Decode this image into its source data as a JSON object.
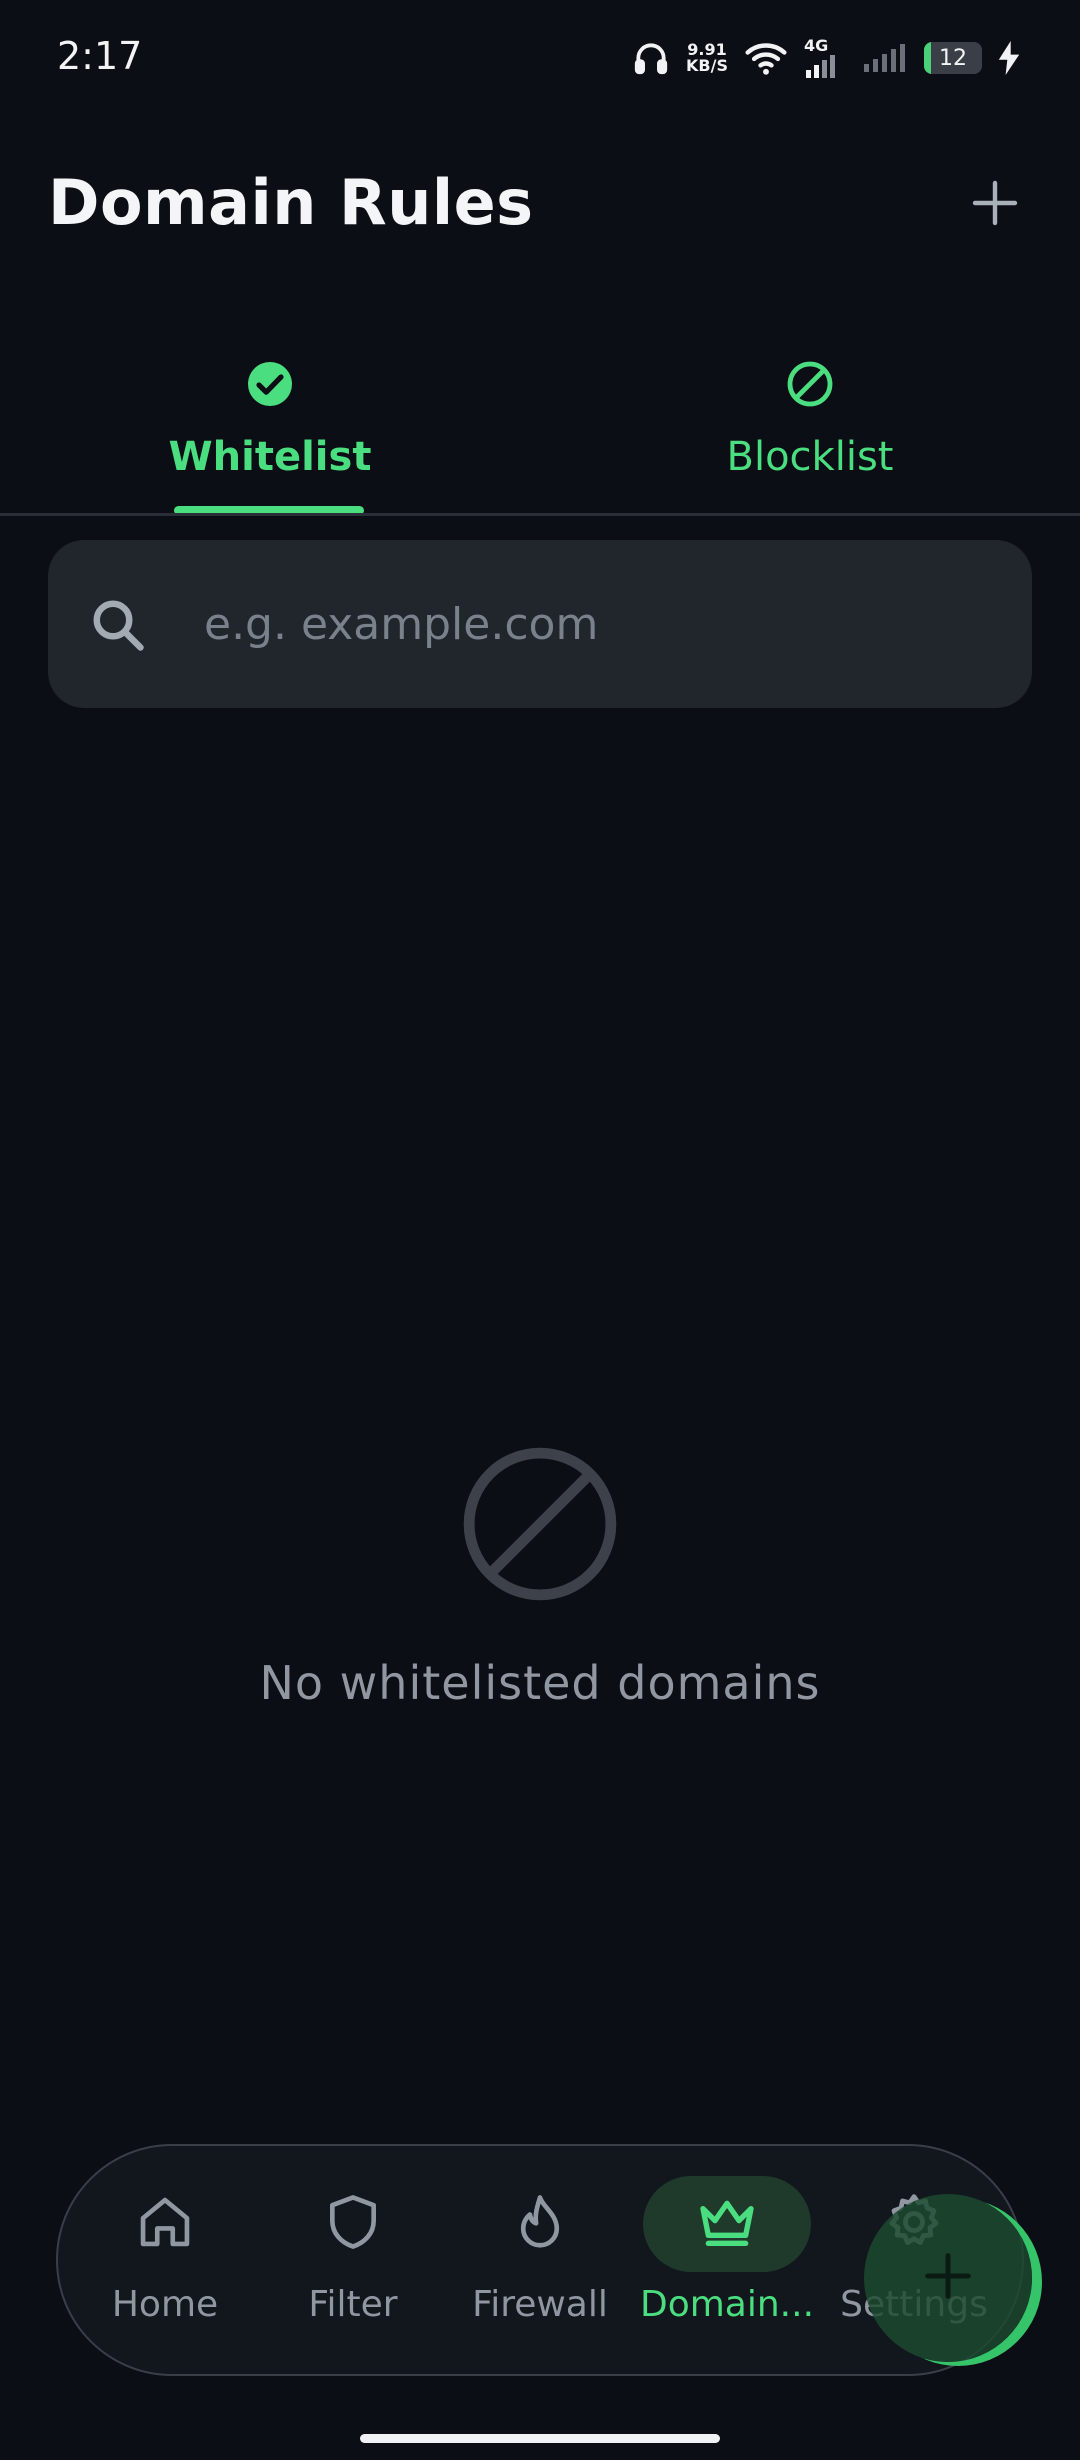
{
  "status_bar": {
    "time": "2:17",
    "net_speed_value": "9.91",
    "net_speed_unit": "KB/S",
    "network_type": "4G",
    "battery_level": "12",
    "battery_fraction": 0.12,
    "icons": [
      "headphones-icon",
      "wifi-icon",
      "signal-icon",
      "charging-icon"
    ]
  },
  "header": {
    "title": "Domain Rules",
    "add_icon": "plus-icon"
  },
  "tabs": [
    {
      "label": "Whitelist",
      "icon": "check-circle-icon",
      "selected": true
    },
    {
      "label": "Blocklist",
      "icon": "block-icon",
      "selected": false
    }
  ],
  "search": {
    "value": "",
    "placeholder": "e.g. example.com",
    "icon": "search-icon"
  },
  "empty_state": {
    "icon": "block-icon",
    "message": "No whitelisted domains"
  },
  "bottom_nav": [
    {
      "label": "Home",
      "icon": "home-icon",
      "active": false
    },
    {
      "label": "Filter",
      "icon": "shield-icon",
      "active": false
    },
    {
      "label": "Firewall",
      "icon": "flame-icon",
      "active": false
    },
    {
      "label": "Domain...",
      "icon": "crown-icon",
      "active": true
    },
    {
      "label": "Settings",
      "icon": "gear-icon",
      "active": false
    }
  ],
  "fab": {
    "icon": "plus-icon"
  },
  "colors": {
    "background": "#0b0e14",
    "accent": "#4ade80",
    "surface": "#21252c",
    "muted_text": "#9197a0"
  }
}
